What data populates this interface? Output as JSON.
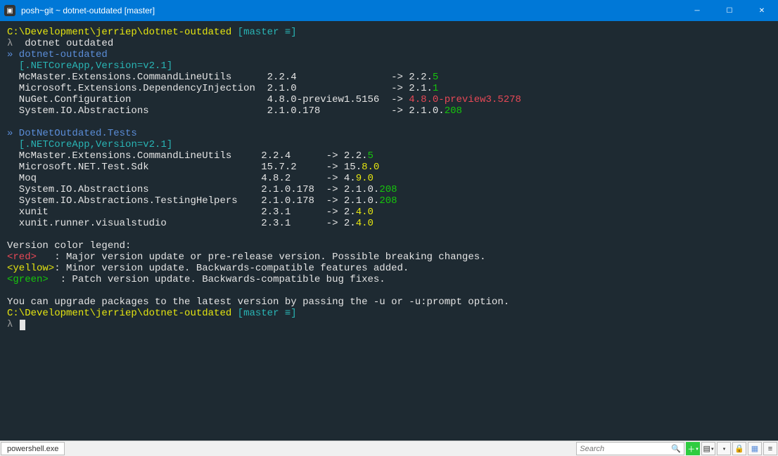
{
  "window": {
    "title": "posh~git ~ dotnet-outdated [master]"
  },
  "prompt": {
    "path": "C:\\Development\\jerriep\\dotnet-outdated",
    "branch_open": "[",
    "branch": "master ≡",
    "branch_close": "]",
    "symbol": "λ"
  },
  "command": "dotnet outdated",
  "projects": [
    {
      "marker": "»",
      "name": "dotnet-outdated",
      "framework": "[.NETCoreApp,Version=v2.1]",
      "packages": [
        {
          "name": "McMaster.Extensions.CommandLineUtils",
          "cur": "2.2.4",
          "arrow": "->",
          "latPrefix": "2.2.",
          "latSuffix": "5",
          "sev": "green"
        },
        {
          "name": "Microsoft.Extensions.DependencyInjection",
          "cur": "2.1.0",
          "arrow": "->",
          "latPrefix": "2.1.",
          "latSuffix": "1",
          "sev": "green"
        },
        {
          "name": "NuGet.Configuration",
          "cur": "4.8.0-preview1.5156",
          "arrow": "->",
          "latPrefix": "",
          "latSuffix": "4.8.0-preview3.5278",
          "sev": "red"
        },
        {
          "name": "System.IO.Abstractions",
          "cur": "2.1.0.178",
          "arrow": "->",
          "latPrefix": "2.1.0.",
          "latSuffix": "208",
          "sev": "green"
        }
      ],
      "nameCol": 41,
      "curCol": 20
    },
    {
      "marker": "»",
      "name": "DotNetOutdated.Tests",
      "framework": "[.NETCoreApp,Version=v2.1]",
      "packages": [
        {
          "name": "McMaster.Extensions.CommandLineUtils",
          "cur": "2.2.4",
          "arrow": "->",
          "latPrefix": "2.2.",
          "latSuffix": "5",
          "sev": "green"
        },
        {
          "name": "Microsoft.NET.Test.Sdk",
          "cur": "15.7.2",
          "arrow": "->",
          "latPrefix": "15.",
          "latSuffix": "8.0",
          "sev": "yellow"
        },
        {
          "name": "Moq",
          "cur": "4.8.2",
          "arrow": "->",
          "latPrefix": "4.",
          "latSuffix": "9.0",
          "sev": "yellow"
        },
        {
          "name": "System.IO.Abstractions",
          "cur": "2.1.0.178",
          "arrow": "->",
          "latPrefix": "2.1.0.",
          "latSuffix": "208",
          "sev": "green"
        },
        {
          "name": "System.IO.Abstractions.TestingHelpers",
          "cur": "2.1.0.178",
          "arrow": "->",
          "latPrefix": "2.1.0.",
          "latSuffix": "208",
          "sev": "green"
        },
        {
          "name": "xunit",
          "cur": "2.3.1",
          "arrow": "->",
          "latPrefix": "2.",
          "latSuffix": "4.0",
          "sev": "yellow"
        },
        {
          "name": "xunit.runner.visualstudio",
          "cur": "2.3.1",
          "arrow": "->",
          "latPrefix": "2.",
          "latSuffix": "4.0",
          "sev": "yellow"
        }
      ],
      "nameCol": 40,
      "curCol": 10
    }
  ],
  "legend": {
    "title": "Version color legend:",
    "red": {
      "tag": "<red>",
      "desc": ": Major version update or pre-release version. Possible breaking changes."
    },
    "yellow": {
      "tag": "<yellow>",
      "desc": ": Minor version update. Backwards-compatible features added."
    },
    "green": {
      "tag": "<green>",
      "desc": ": Patch version update. Backwards-compatible bug fixes."
    }
  },
  "footer": "You can upgrade packages to the latest version by passing the -u or -u:prompt option.",
  "statusbar": {
    "tab": "powershell.exe",
    "search_placeholder": "Search"
  }
}
